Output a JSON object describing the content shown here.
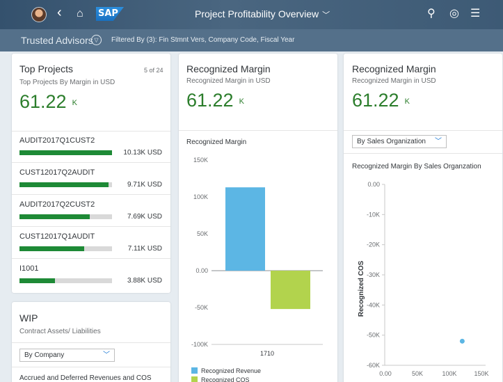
{
  "shell": {
    "app_title": "Project Profitability Overview",
    "title_chevron": "chevron-down-icon",
    "logo_text": "SAP"
  },
  "subheader": {
    "team_name": "Trusted Advisors",
    "filter_text": "Filtered By (3): Fin Stmnt Vers, Company Code, Fiscal Year"
  },
  "top_projects": {
    "title": "Top Projects",
    "subtitle": "Top Projects By Margin in USD",
    "counter": "5 of 24",
    "kpi_value": "61.22",
    "kpi_unit": "K",
    "items": [
      {
        "name": "AUDIT2017Q1CUST2",
        "value": "10.13K USD",
        "fraction": 1.0
      },
      {
        "name": "CUST12017Q2AUDIT",
        "value": "9.71K USD",
        "fraction": 0.96
      },
      {
        "name": "AUDIT2017Q2CUST2",
        "value": "7.69K USD",
        "fraction": 0.76
      },
      {
        "name": "CUST12017Q1AUDIT",
        "value": "7.11K USD",
        "fraction": 0.7
      },
      {
        "name": "I1001",
        "value": "3.88K USD",
        "fraction": 0.38
      }
    ],
    "bar_color": "#1e8a36"
  },
  "wip": {
    "title": "WIP",
    "subtitle": "Contract Assets/ Liabilities",
    "select_value": "By Company",
    "footer_text": "Accrued and Deferred Revenues and COS"
  },
  "margin_card_1": {
    "title": "Recognized Margin",
    "subtitle": "Recognized Margin in USD",
    "kpi_value": "61.22",
    "kpi_unit": "K",
    "chart_title": "Recognized Margin"
  },
  "margin_card_2": {
    "title": "Recognized Margin",
    "subtitle": "Recognized Margin in USD",
    "kpi_value": "61.22",
    "kpi_unit": "K",
    "select_value": "By Sales Organization",
    "chart_title": "Recognized Margin By Sales Organzation"
  },
  "chart_data": [
    {
      "type": "bar",
      "title": "Recognized Margin",
      "categories": [
        "1710"
      ],
      "series": [
        {
          "name": "Recognized Revenue",
          "values": [
            113000
          ],
          "color": "#5cb6e4"
        },
        {
          "name": "Recognized COS",
          "values": [
            -52000
          ],
          "color": "#b2d34d"
        }
      ],
      "yticks": [
        "150K",
        "100K",
        "50K",
        "0.00",
        "-50K",
        "-100K"
      ],
      "ylim": [
        -100000,
        150000
      ],
      "legend": "bottom-left"
    },
    {
      "type": "scatter",
      "title": "Recognized Margin By Sales Organzation",
      "ylabel": "Recognized COS",
      "points": [
        {
          "x": 120000,
          "y": -52000
        }
      ],
      "point_color": "#5cb6e4",
      "yticks": [
        "0.00",
        "-10K",
        "-20K",
        "-30K",
        "-40K",
        "-50K",
        "-60K"
      ],
      "xticks": [
        "0.00",
        "50K",
        "100K",
        "150K"
      ],
      "xlim": [
        0,
        150000
      ],
      "ylim": [
        -60000,
        0
      ]
    }
  ]
}
